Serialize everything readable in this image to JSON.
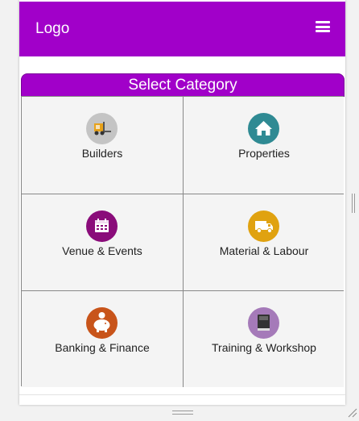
{
  "header": {
    "logo_text": "Logo",
    "menu_icon": "hamburger-icon",
    "bg_color": "#a100c9"
  },
  "category": {
    "title": "Select Category",
    "items": [
      {
        "label": "Builders",
        "icon": "forklift-icon",
        "color": "#c4c4c4"
      },
      {
        "label": "Properties",
        "icon": "home-icon",
        "color": "#2f8a93"
      },
      {
        "label": "Venue & Events",
        "icon": "calendar-icon",
        "color": "#8a0c7a"
      },
      {
        "label": "Material & Labour",
        "icon": "truck-icon",
        "color": "#e0a210"
      },
      {
        "label": "Banking & Finance",
        "icon": "piggy-bank-icon",
        "color": "#c8541a"
      },
      {
        "label": "Training & Workshop",
        "icon": "book-icon",
        "color": "#a57ab9"
      }
    ]
  }
}
